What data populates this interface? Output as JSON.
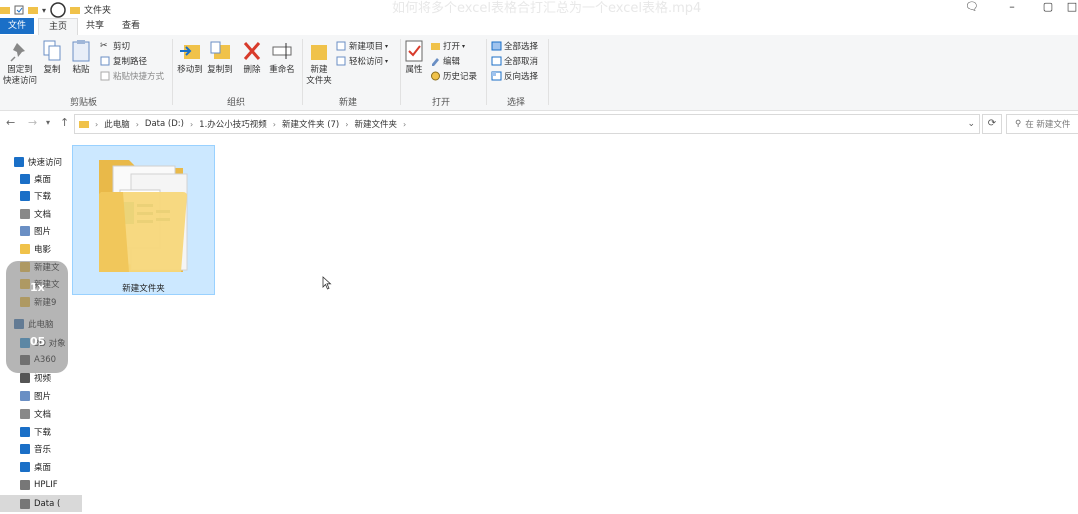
{
  "window": {
    "title": "文件夹",
    "video_title": "如何将多个excel表格合打汇总为一个excel表格.mp4"
  },
  "tabs": [
    {
      "label": "文件"
    },
    {
      "label": "主页"
    },
    {
      "label": "共享"
    },
    {
      "label": "查看"
    }
  ],
  "ribbon": {
    "clipboard": {
      "group_label": "剪贴板",
      "pin_label_1": "固定到",
      "pin_label_2": "快速访问",
      "copy_label": "复制",
      "paste_label": "粘贴",
      "cut_label": "剪切",
      "copy_path_label": "复制路径",
      "paste_shortcut_label": "粘贴快捷方式"
    },
    "organize": {
      "group_label": "组织",
      "move_to_label": "移动到",
      "copy_to_label": "复制到",
      "delete_label": "删除",
      "rename_label": "重命名"
    },
    "new": {
      "group_label": "新建",
      "new_folder_label_1": "新建",
      "new_folder_label_2": "文件夹",
      "new_item_label": "新建项目",
      "easy_access_label": "轻松访问"
    },
    "open": {
      "group_label": "打开",
      "properties_label": "属性",
      "open_label": "打开",
      "edit_label": "编辑",
      "history_label": "历史记录"
    },
    "select": {
      "group_label": "选择",
      "select_all_label": "全部选择",
      "select_none_label": "全部取消",
      "invert_label": "反向选择"
    }
  },
  "address": {
    "crumbs": [
      "此电脑",
      "Data (D:)",
      "1.办公小技巧视频",
      "新建文件夹 (7)",
      "新建文件夹"
    ],
    "search_placeholder": "在 新建文件"
  },
  "navpane": {
    "items": [
      {
        "label": "快速访问",
        "icon": "star-icon"
      },
      {
        "label": "桌面",
        "icon": "desktop-icon"
      },
      {
        "label": "下载",
        "icon": "download-icon"
      },
      {
        "label": "文档",
        "icon": "document-icon"
      },
      {
        "label": "图片",
        "icon": "picture-icon"
      },
      {
        "label": "电影",
        "icon": "folder-icon"
      },
      {
        "label": "新建文",
        "icon": "folder-icon"
      },
      {
        "label": "新建文",
        "icon": "folder-icon"
      },
      {
        "label": "新建9",
        "icon": "folder-icon"
      },
      {
        "label": "此电脑",
        "icon": "computer-icon"
      },
      {
        "label": "3D 对象",
        "icon": "3d-icon"
      },
      {
        "label": "A360",
        "icon": "cloud-icon"
      },
      {
        "label": "视频",
        "icon": "video-icon"
      },
      {
        "label": "图片",
        "icon": "picture-icon"
      },
      {
        "label": "文档",
        "icon": "document-icon"
      },
      {
        "label": "下载",
        "icon": "download-icon"
      },
      {
        "label": "音乐",
        "icon": "music-icon"
      },
      {
        "label": "桌面",
        "icon": "desktop-icon"
      },
      {
        "label": "HPLIF",
        "icon": "drive-icon"
      },
      {
        "label": "Data (",
        "icon": "drive-icon"
      }
    ],
    "overlay_top": "1x",
    "overlay_bottom": "05"
  },
  "content": {
    "items": [
      {
        "label": "新建文件夹"
      }
    ]
  },
  "colors": {
    "file_tab": "#1a6fc7",
    "selection_bg": "#cce8ff",
    "selection_border": "#99d1ff",
    "folder": "#f7d77a"
  }
}
